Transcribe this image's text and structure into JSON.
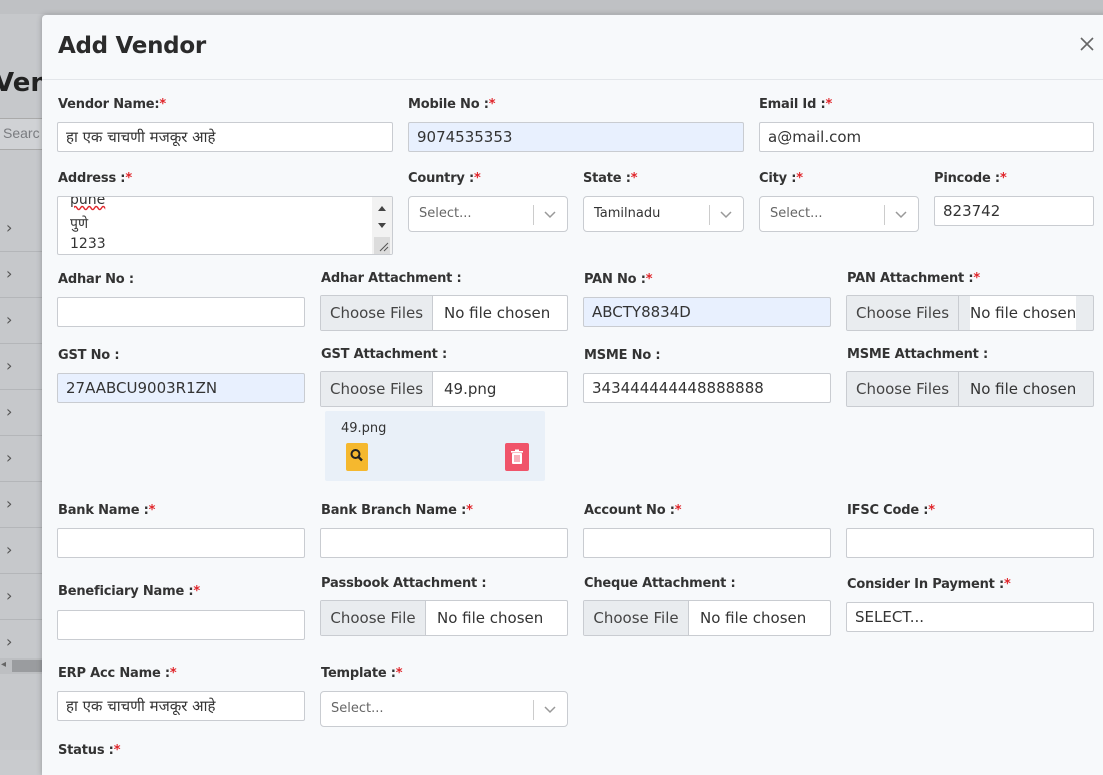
{
  "background": {
    "title": "Vend",
    "search_placeholder": "Searc",
    "row_count": 10
  },
  "modal": {
    "title": "Add Vendor",
    "close_icon": "close-icon"
  },
  "form": {
    "vendor_name": {
      "label": "Vendor Name:",
      "value": "हा एक चाचणी मजकूर आहे"
    },
    "mobile_no": {
      "label": "Mobile No :",
      "value": "9074535353"
    },
    "email_id": {
      "label": "Email Id :",
      "value": "a@mail.com"
    },
    "address": {
      "label": "Address :",
      "lines": [
        "pune",
        "पुणे",
        "1233"
      ]
    },
    "country": {
      "label": "Country :",
      "value": "Select..."
    },
    "state": {
      "label": "State :",
      "value": "Tamilnadu"
    },
    "city": {
      "label": "City :",
      "value": "Select..."
    },
    "pincode": {
      "label": "Pincode :",
      "value": "823742"
    },
    "adhar_no": {
      "label": "Adhar No :",
      "value": ""
    },
    "adhar_attachment": {
      "label": "Adhar Attachment :",
      "button": "Choose Files",
      "file": "No file chosen"
    },
    "pan_no": {
      "label": "PAN No :",
      "value": "ABCTY8834D"
    },
    "pan_attachment": {
      "label": "PAN Attachment :",
      "button": "Choose Files",
      "file": "No file chosen"
    },
    "gst_no": {
      "label": "GST No :",
      "value": "27AABCU9003R1ZN"
    },
    "gst_attachment": {
      "label": "GST Attachment :",
      "button": "Choose Files",
      "file": "49.png"
    },
    "msme_no": {
      "label": "MSME No :",
      "value": "343444444448888888"
    },
    "msme_attachment": {
      "label": "MSME Attachment :",
      "button": "Choose Files",
      "file": "No file chosen"
    },
    "gst_uploaded": {
      "file_name": "49.png",
      "view_icon": "search-icon",
      "delete_icon": "trash-icon"
    },
    "bank_name": {
      "label": "Bank Name :",
      "value": ""
    },
    "bank_branch_name": {
      "label": "Bank Branch Name :",
      "value": ""
    },
    "account_no": {
      "label": "Account No :",
      "value": ""
    },
    "ifsc_code": {
      "label": "IFSC Code :",
      "value": ""
    },
    "beneficiary_name": {
      "label": "Beneficiary Name :",
      "value": ""
    },
    "passbook_attachment": {
      "label": "Passbook Attachment :",
      "button": "Choose File",
      "file": "No file chosen"
    },
    "cheque_attachment": {
      "label": "Cheque Attachment :",
      "button": "Choose File",
      "file": "No file chosen"
    },
    "consider_in_payment": {
      "label": "Consider In Payment :",
      "value": "SELECT..."
    },
    "erp_acc_name": {
      "label": "ERP Acc Name :",
      "value": "हा एक चाचणी मजकूर आहे"
    },
    "template": {
      "label": "Template :",
      "value": "Select..."
    },
    "status": {
      "label": "Status :"
    }
  },
  "colors": {
    "required": "#e0262b",
    "autofill": "#e8f0fe",
    "view_button": "#f5b82e",
    "delete_button": "#f0546a"
  }
}
